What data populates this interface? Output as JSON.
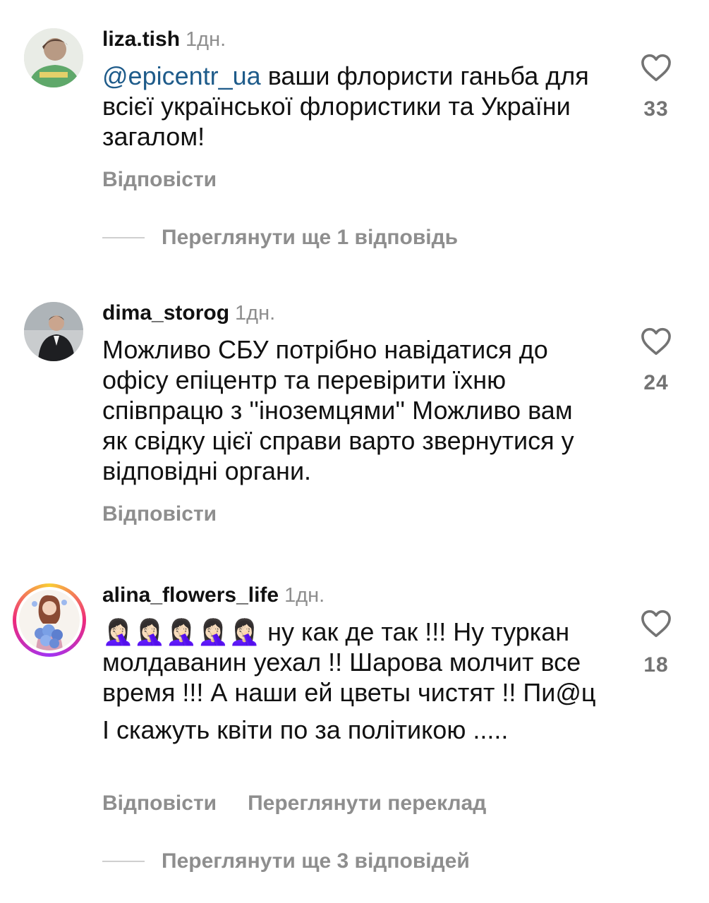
{
  "comments": [
    {
      "username": "liza.tish",
      "time": "1дн.",
      "mention": "@epicentr_ua",
      "text_rest": " ваши флористи ганьба для всієї української флористики та України загалом!",
      "likes": "33",
      "reply": "Відповісти",
      "more_replies": "Переглянути ще 1 відповідь"
    },
    {
      "username": "dima_storog",
      "time": "1дн.",
      "text": "Можливо СБУ потрібно навідатися до офісу епіцентр та перевірити їхню співпрацю з ''іноземцями'' Можливо вам як свідку цієї справи варто звернутися у відповідні органи.",
      "likes": "24",
      "reply": "Відповісти"
    },
    {
      "username": "alina_flowers_life",
      "time": "1дн.",
      "emoji": "🤦🏻‍♀️🤦🏻‍♀️🤦🏻‍♀️🤦🏻‍♀️🤦🏻‍♀️",
      "text_line1": " ну как де так !!! Ну туркан молдаванин уехал !! Шарова молчит все время !!! А наши ей цветы чистят !! Пи@ц",
      "text_line2": "І скажуть квіти по за політикою .....",
      "likes": "18",
      "reply": "Відповісти",
      "translate": "Переглянути переклад",
      "more_replies": "Переглянути ще 3 відповідей"
    }
  ]
}
